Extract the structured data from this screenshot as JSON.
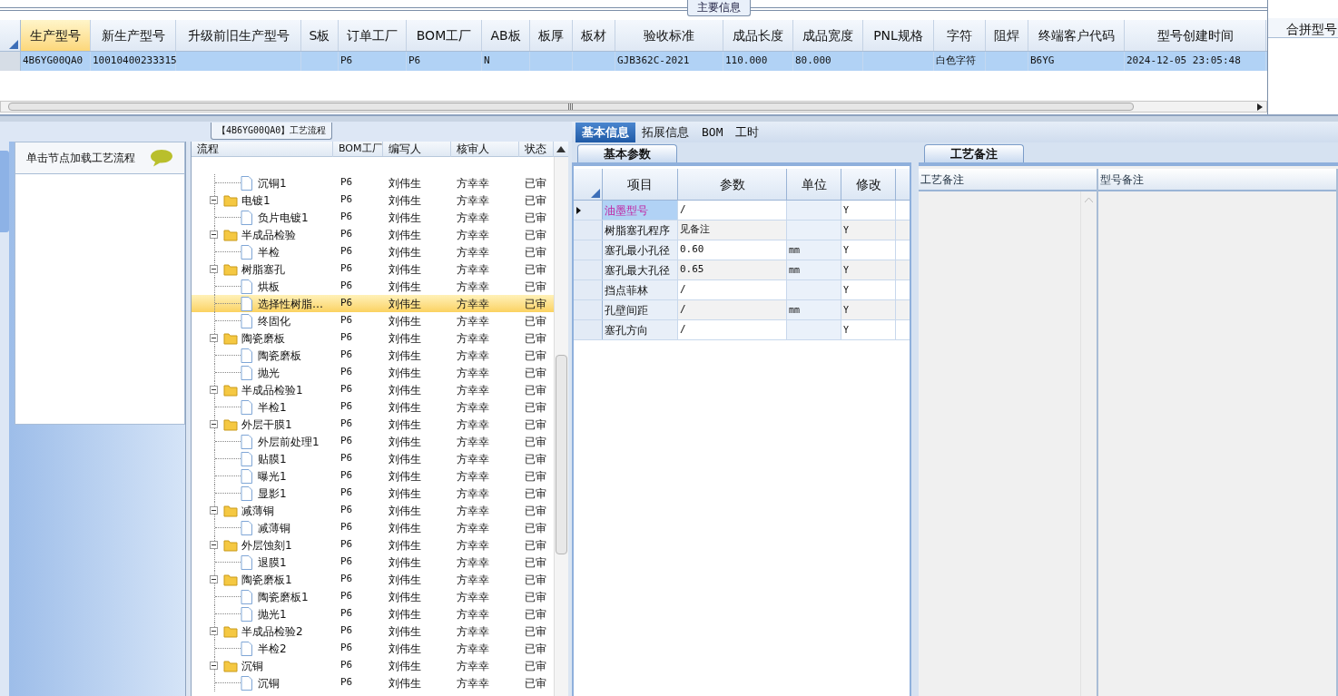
{
  "main_info": {
    "title": "主要信息",
    "columns": [
      {
        "label": "生产型号",
        "selected": true
      },
      {
        "label": "新生产型号",
        "selected": false
      },
      {
        "label": "升级前旧生产型号",
        "selected": false
      },
      {
        "label": "S板",
        "selected": false
      },
      {
        "label": "订单工厂",
        "selected": false
      },
      {
        "label": "BOM工厂",
        "selected": false
      },
      {
        "label": "AB板",
        "selected": false
      },
      {
        "label": "板厚",
        "selected": false
      },
      {
        "label": "板材",
        "selected": false
      },
      {
        "label": "验收标准",
        "selected": false
      },
      {
        "label": "成品长度",
        "selected": false
      },
      {
        "label": "成品宽度",
        "selected": false
      },
      {
        "label": "PNL规格",
        "selected": false
      },
      {
        "label": "字符",
        "selected": false
      },
      {
        "label": "阻焊",
        "selected": false
      },
      {
        "label": "终端客户代码",
        "selected": false
      },
      {
        "label": "型号创建时间",
        "selected": false
      }
    ],
    "rows": [
      {
        "selected": true,
        "cells": [
          "4B6YG00QA0",
          "10010400233315",
          null,
          null,
          "P6",
          "P6",
          "N",
          null,
          null,
          "GJB362C-2021",
          "110.000",
          "80.000",
          null,
          "白色字符",
          null,
          "B6YG",
          "2024-12-05 23:05:48"
        ]
      }
    ]
  },
  "merge_panel": {
    "title": "合拼型号"
  },
  "process": {
    "title": "【4B6YG00QA0】工艺流程",
    "hint": "单击节点加载工艺流程",
    "columns": [
      "流程",
      "BOM工厂",
      "编写人",
      "核审人",
      "状态"
    ],
    "nodes": [
      {
        "kind": "file",
        "name": "沉铜1",
        "bom": "P6",
        "writer": "刘伟生",
        "reviewer": "方幸幸",
        "status": "已审",
        "selected": false
      },
      {
        "kind": "folder",
        "name": "电镀1",
        "bom": "P6",
        "writer": "刘伟生",
        "reviewer": "方幸幸",
        "status": "已审",
        "selected": false,
        "expanded": true,
        "children": [
          {
            "kind": "file",
            "name": "负片电镀1",
            "bom": "P6",
            "writer": "刘伟生",
            "reviewer": "方幸幸",
            "status": "已审",
            "selected": false
          }
        ]
      },
      {
        "kind": "folder",
        "name": "半成品检验",
        "bom": "P6",
        "writer": "刘伟生",
        "reviewer": "方幸幸",
        "status": "已审",
        "selected": false,
        "expanded": true,
        "children": [
          {
            "kind": "file",
            "name": "半检",
            "bom": "P6",
            "writer": "刘伟生",
            "reviewer": "方幸幸",
            "status": "已审",
            "selected": false
          }
        ]
      },
      {
        "kind": "folder",
        "name": "树脂塞孔",
        "bom": "P6",
        "writer": "刘伟生",
        "reviewer": "方幸幸",
        "status": "已审",
        "selected": false,
        "expanded": true,
        "children": [
          {
            "kind": "file",
            "name": "烘板",
            "bom": "P6",
            "writer": "刘伟生",
            "reviewer": "方幸幸",
            "status": "已审",
            "selected": false
          },
          {
            "kind": "file",
            "name": "选择性树脂…",
            "bom": "P6",
            "writer": "刘伟生",
            "reviewer": "方幸幸",
            "status": "已审",
            "selected": true
          },
          {
            "kind": "file",
            "name": "终固化",
            "bom": "P6",
            "writer": "刘伟生",
            "reviewer": "方幸幸",
            "status": "已审",
            "selected": false
          }
        ]
      },
      {
        "kind": "folder",
        "name": "陶瓷磨板",
        "bom": "P6",
        "writer": "刘伟生",
        "reviewer": "方幸幸",
        "status": "已审",
        "selected": false,
        "expanded": true,
        "children": [
          {
            "kind": "file",
            "name": "陶瓷磨板",
            "bom": "P6",
            "writer": "刘伟生",
            "reviewer": "方幸幸",
            "status": "已审",
            "selected": false
          },
          {
            "kind": "file",
            "name": "抛光",
            "bom": "P6",
            "writer": "刘伟生",
            "reviewer": "方幸幸",
            "status": "已审",
            "selected": false
          }
        ]
      },
      {
        "kind": "folder",
        "name": "半成品检验1",
        "bom": "P6",
        "writer": "刘伟生",
        "reviewer": "方幸幸",
        "status": "已审",
        "selected": false,
        "expanded": true,
        "children": [
          {
            "kind": "file",
            "name": "半检1",
            "bom": "P6",
            "writer": "刘伟生",
            "reviewer": "方幸幸",
            "status": "已审",
            "selected": false
          }
        ]
      },
      {
        "kind": "folder",
        "name": "外层干膜1",
        "bom": "P6",
        "writer": "刘伟生",
        "reviewer": "方幸幸",
        "status": "已审",
        "selected": false,
        "expanded": true,
        "children": [
          {
            "kind": "file",
            "name": "外层前处理1",
            "bom": "P6",
            "writer": "刘伟生",
            "reviewer": "方幸幸",
            "status": "已审",
            "selected": false
          },
          {
            "kind": "file",
            "name": "贴膜1",
            "bom": "P6",
            "writer": "刘伟生",
            "reviewer": "方幸幸",
            "status": "已审",
            "selected": false
          },
          {
            "kind": "file",
            "name": "曝光1",
            "bom": "P6",
            "writer": "刘伟生",
            "reviewer": "方幸幸",
            "status": "已审",
            "selected": false
          },
          {
            "kind": "file",
            "name": "显影1",
            "bom": "P6",
            "writer": "刘伟生",
            "reviewer": "方幸幸",
            "status": "已审",
            "selected": false
          }
        ]
      },
      {
        "kind": "folder",
        "name": "减薄铜",
        "bom": "P6",
        "writer": "刘伟生",
        "reviewer": "方幸幸",
        "status": "已审",
        "selected": false,
        "expanded": true,
        "children": [
          {
            "kind": "file",
            "name": "减薄铜",
            "bom": "P6",
            "writer": "刘伟生",
            "reviewer": "方幸幸",
            "status": "已审",
            "selected": false
          }
        ]
      },
      {
        "kind": "folder",
        "name": "外层蚀刻1",
        "bom": "P6",
        "writer": "刘伟生",
        "reviewer": "方幸幸",
        "status": "已审",
        "selected": false,
        "expanded": true,
        "children": [
          {
            "kind": "file",
            "name": "退膜1",
            "bom": "P6",
            "writer": "刘伟生",
            "reviewer": "方幸幸",
            "status": "已审",
            "selected": false
          }
        ]
      },
      {
        "kind": "folder",
        "name": "陶瓷磨板1",
        "bom": "P6",
        "writer": "刘伟生",
        "reviewer": "方幸幸",
        "status": "已审",
        "selected": false,
        "expanded": true,
        "children": [
          {
            "kind": "file",
            "name": "陶瓷磨板1",
            "bom": "P6",
            "writer": "刘伟生",
            "reviewer": "方幸幸",
            "status": "已审",
            "selected": false
          },
          {
            "kind": "file",
            "name": "抛光1",
            "bom": "P6",
            "writer": "刘伟生",
            "reviewer": "方幸幸",
            "status": "已审",
            "selected": false
          }
        ]
      },
      {
        "kind": "folder",
        "name": "半成品检验2",
        "bom": "P6",
        "writer": "刘伟生",
        "reviewer": "方幸幸",
        "status": "已审",
        "selected": false,
        "expanded": true,
        "children": [
          {
            "kind": "file",
            "name": "半检2",
            "bom": "P6",
            "writer": "刘伟生",
            "reviewer": "方幸幸",
            "status": "已审",
            "selected": false
          }
        ]
      },
      {
        "kind": "folder",
        "name": "沉铜",
        "bom": "P6",
        "writer": "刘伟生",
        "reviewer": "方幸幸",
        "status": "已审",
        "selected": false,
        "expanded": true,
        "children": [
          {
            "kind": "file",
            "name": "沉铜",
            "bom": "P6",
            "writer": "刘伟生",
            "reviewer": "方幸幸",
            "status": "已审",
            "selected": false
          }
        ]
      }
    ]
  },
  "detail_tabs": [
    {
      "label": "基本信息",
      "selected": true
    },
    {
      "label": "拓展信息",
      "selected": false
    },
    {
      "label": "BOM",
      "selected": false
    },
    {
      "label": "工时",
      "selected": false
    }
  ],
  "basic_params": {
    "tab": "基本参数",
    "columns": [
      "项目",
      "参数",
      "单位",
      "修改"
    ],
    "rows": [
      {
        "item": "油墨型号",
        "value": "/",
        "unit": null,
        "modify": "Y",
        "selected": true
      },
      {
        "item": "树脂塞孔程序",
        "value": "见备注",
        "unit": null,
        "modify": "Y",
        "selected": false
      },
      {
        "item": "塞孔最小孔径",
        "value": "0.60",
        "unit": "mm",
        "modify": "Y",
        "selected": false
      },
      {
        "item": "塞孔最大孔径",
        "value": "0.65",
        "unit": "mm",
        "modify": "Y",
        "selected": false
      },
      {
        "item": "挡点菲林",
        "value": "/",
        "unit": null,
        "modify": "Y",
        "selected": false
      },
      {
        "item": "孔壁间距",
        "value": "/",
        "unit": "mm",
        "modify": "Y",
        "selected": false
      },
      {
        "item": "塞孔方向",
        "value": "/",
        "unit": null,
        "modify": "Y",
        "selected": false
      }
    ]
  },
  "remarks": {
    "tab": "工艺备注",
    "columns": [
      "工艺备注",
      "型号备注"
    ]
  }
}
